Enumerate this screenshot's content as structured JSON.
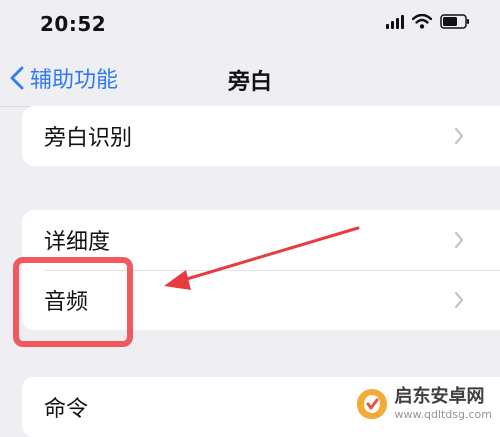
{
  "status_bar": {
    "time": "20:52",
    "icons": [
      "signal-icon",
      "wifi-icon",
      "battery-icon"
    ]
  },
  "nav": {
    "back_label": "辅助功能",
    "title": "旁白"
  },
  "groups": [
    {
      "items": [
        {
          "label": "旁白识别"
        }
      ]
    },
    {
      "items": [
        {
          "label": "详细度"
        },
        {
          "label": "音频"
        }
      ]
    },
    {
      "items": [
        {
          "label": "命令"
        }
      ]
    }
  ],
  "watermark": {
    "brand": "启东安卓网",
    "url": "www.qdltdsg.com"
  },
  "colors": {
    "background": "#eeeef3",
    "accent": "#2f7bf5",
    "annotation": "#e83b41",
    "chevron": "#c4c4c8"
  }
}
